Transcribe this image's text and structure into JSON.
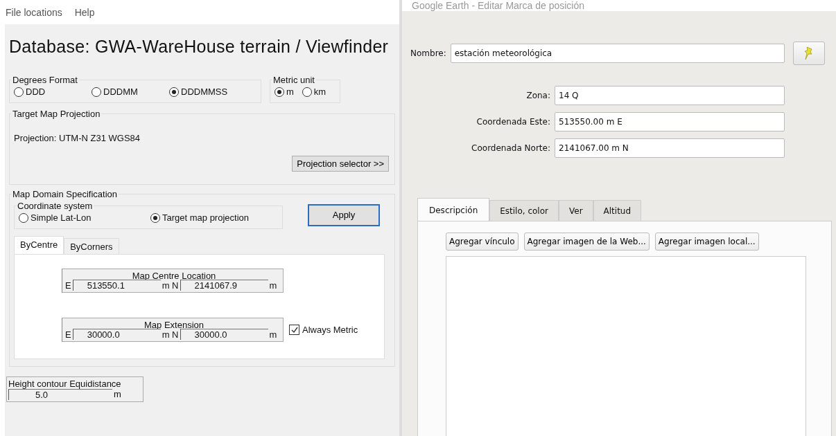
{
  "menu": [
    "File locations",
    "Help"
  ],
  "title": "Database: GWA-WareHouse terrain / Viewfinder",
  "degrees_format": {
    "label": "Degrees Format",
    "options": [
      {
        "label": "DDD",
        "selected": false
      },
      {
        "label": "DDDMM",
        "selected": false
      },
      {
        "label": "DDDMMSS",
        "selected": true
      }
    ]
  },
  "metric_unit": {
    "label": "Metric unit",
    "options": [
      {
        "label": "m",
        "selected": true
      },
      {
        "label": "km",
        "selected": false
      }
    ]
  },
  "target_projection": {
    "label": "Target Map Projection",
    "text": "Projection: UTM-N Z31 WGS84",
    "button": "Projection selector >>"
  },
  "map_domain": {
    "label": "Map Domain Specification",
    "coordinate_system": {
      "label": "Coordinate system",
      "options": [
        {
          "label": "Simple Lat-Lon",
          "selected": false
        },
        {
          "label": "Target map projection",
          "selected": true
        }
      ]
    },
    "apply_button": "Apply",
    "tabs": [
      {
        "label": "ByCentre",
        "selected": true
      },
      {
        "label": "ByCorners",
        "selected": false
      }
    ],
    "boxes": [
      {
        "label": "Map Centre Location",
        "e_label": "E",
        "e_value": "513550.1",
        "n_label": "m N",
        "n_value": "2141067.9",
        "unit": "m"
      },
      {
        "label": "Map Extension",
        "e_label": "E",
        "e_value": "30000.0",
        "n_label": "m N",
        "n_value": "30000.0",
        "unit": "m"
      }
    ],
    "always_metric": {
      "label": "Always Metric",
      "checked": true
    }
  },
  "height_contour": {
    "label": "Height contour Equidistance",
    "value": "5.0",
    "unit": "m"
  },
  "dialog": {
    "title": "Google Earth - Editar Marca de posición",
    "name_label": "Nombre:",
    "name_value": "estación meteorológica",
    "fields": [
      {
        "label": "Zona:",
        "value": "14 Q"
      },
      {
        "label": "Coordenada Este:",
        "value": "513550.00 m E"
      },
      {
        "label": "Coordenada Norte:",
        "value": "2141067.00 m N"
      }
    ],
    "tabs": [
      {
        "label": "Descripción",
        "selected": true
      },
      {
        "label": "Estilo, color",
        "selected": false
      },
      {
        "label": "Ver",
        "selected": false
      },
      {
        "label": "Altitud",
        "selected": false
      }
    ],
    "buttons": [
      "Agregar vínculo",
      "Agregar imagen de la Web...",
      "Agregar imagen local..."
    ]
  }
}
